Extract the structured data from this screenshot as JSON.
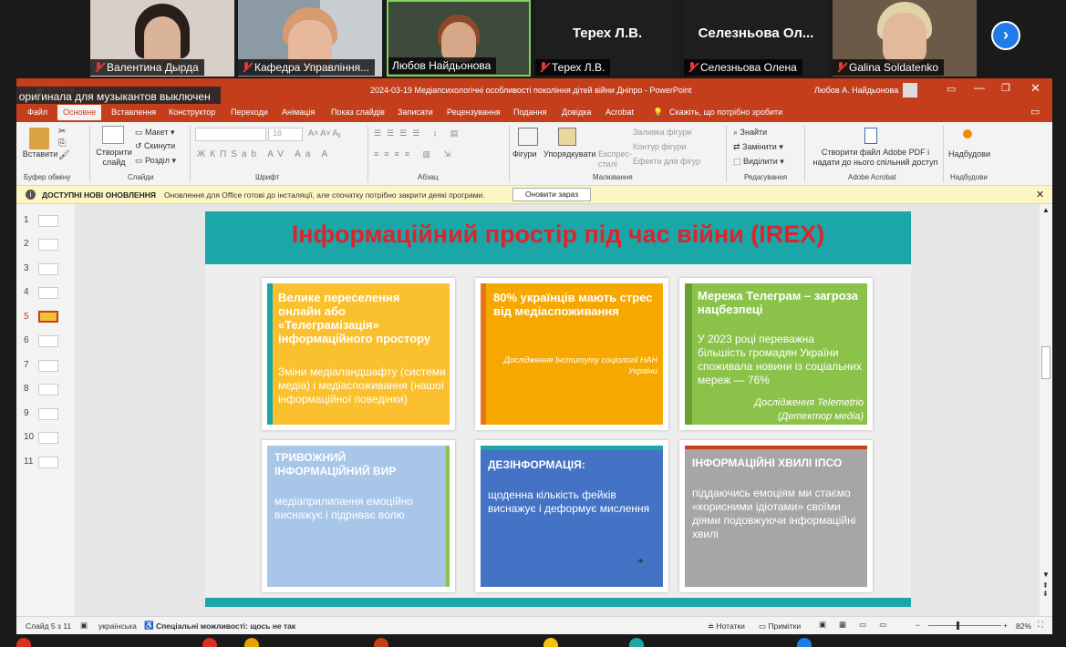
{
  "participants": [
    {
      "name": "Валентина Дырда",
      "muted": true
    },
    {
      "name": "Кафедра Управління...",
      "muted": true
    },
    {
      "name": "Любов Найдьонова",
      "muted": false
    },
    {
      "name": "Терех Л.В.",
      "display": "Терех Л.В.",
      "muted": true
    },
    {
      "name": "Селезньова Олена",
      "display": "Селезньова  Ол...",
      "muted": true
    },
    {
      "name": "Galina Soldatenko",
      "muted": true
    }
  ],
  "banner": "вук оригинала для музыкантов выключен",
  "ppt": {
    "window_title": "2024-03-19 Медіапсихологічні особливості покоління дітей війни Дніпро  -  PowerPoint",
    "user": "Любов А. Найдьонова",
    "tabs": [
      "Файл",
      "Основне",
      "Вставлення",
      "Конструктор",
      "Переходи",
      "Анімація",
      "Показ слайдів",
      "Записати",
      "Рецензування",
      "Подання",
      "Довідка",
      "Acrobat"
    ],
    "tell_me": "Скажіть, що потрібно зробити",
    "ribbon": {
      "paste": "Вставити",
      "clipboard": "Буфер обміну",
      "new_slide": "Створити слайд",
      "layout": "Макет",
      "reset": "Скинути",
      "section": "Розділ",
      "slides": "Слайди",
      "font_size": "18",
      "font": "Шрифт",
      "paragraph": "Абзац",
      "shapes": "Фігури",
      "arrange": "Упорядкувати",
      "quick_styles": "Експрес-стилі",
      "shape_fill": "Заливка фігури",
      "shape_outline": "Контур фігури",
      "shape_effects": "Ефекти для фігур",
      "drawing": "Малювання",
      "find": "Знайти",
      "replace": "Замінити",
      "select": "Виділити",
      "editing": "Редагування",
      "adobe_create": "Створити файл Adobe PDF і надати до нього спільний доступ",
      "adobe_acrobat": "Adobe Acrobat",
      "addins": "Надбудови",
      "addins_group": "Надбудови"
    },
    "update": {
      "title": "ДОСТУПНІ НОВІ ОНОВЛЕННЯ",
      "message": "Оновлення для Office готові до інсталяції, але спочатку потрібно закрити деякі програми.",
      "button": "Оновити зараз"
    },
    "thumbnails": [
      "1",
      "2",
      "3",
      "4",
      "5",
      "6",
      "7",
      "8",
      "9",
      "10",
      "11"
    ],
    "status": {
      "slide": "Слайд 5 з 11",
      "language": "українська",
      "accessibility": "Спеціальні можливості: щось не так",
      "notes": "Нотатки",
      "comments": "Примітки",
      "zoom": "82%"
    }
  },
  "slide": {
    "title": "Інформаційний простір під час війни (IREX)",
    "cards": [
      {
        "heading": "Велике переселення онлайн або «Телеграмізація» інформаційного простору",
        "body": "Зміни медіаландшафту (системи медіа) і медіаспоживання (нашої інформаційної поведінки)"
      },
      {
        "heading": "80% українців мають стрес від медіаспоживання",
        "body": "Дослідження Інституту соціології НАН України"
      },
      {
        "heading": "Мережа Телеграм – загроза нацбезпеці",
        "body": "У 2023 році переважна більшість громадян України споживала новини із соціальних мереж — 76%",
        "source": "Дослідження  Telemetrio (Детектор медіа)"
      },
      {
        "heading": "ТРИВОЖНИЙ ІНФОРМАЦІЙНИЙ ВИР",
        "body": "медіаприлипання емоційно виснажує і підриває волю"
      },
      {
        "heading": "ДЕЗІНФОРМАЦІЯ:",
        "body": "щоденна кількість фейків виснажує і деформує мислення"
      },
      {
        "heading": "ІНФОРМАЦІЙНІ ХВИЛІ ІПСО",
        "body": " піддаючись емоціям ми стаємо  «корисними ідіотами» своїми діями подовжуючи інформаційні хвилі"
      }
    ]
  },
  "colors": {
    "ppt_red": "#c43e1c",
    "teal": "#1ba6a8",
    "title_red": "#d9262e",
    "yellow": "#fbc02d",
    "orange": "#f7a800",
    "green": "#8bc34a",
    "light_blue": "#a7c6e8",
    "blue": "#4472c4",
    "gray": "#a6a6a6"
  }
}
